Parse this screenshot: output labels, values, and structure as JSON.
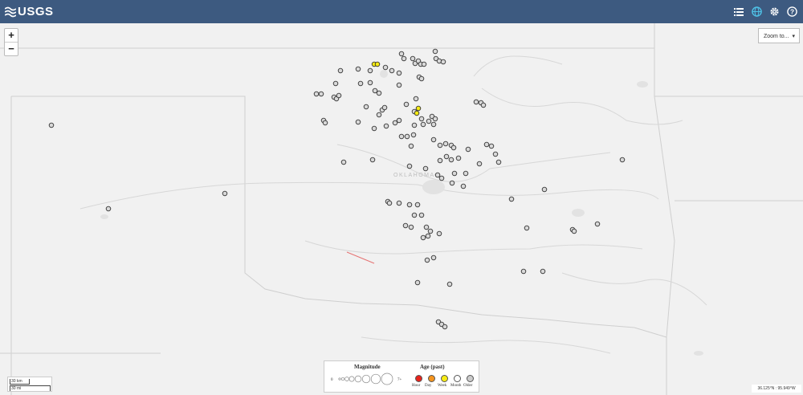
{
  "header": {
    "logo_text": "USGS",
    "icons": [
      "list-icon",
      "globe-icon",
      "gear-icon",
      "help-icon"
    ]
  },
  "map": {
    "state_label": "OKLAHOMA",
    "zoom_in_label": "+",
    "zoom_out_label": "−",
    "zoom_to_label": "Zoom to...",
    "coords_readout": "36.125°N : 95.949°W",
    "scale_km": "30 km",
    "scale_mi": "30 mi"
  },
  "legend": {
    "magnitude_title": "Magnitude",
    "magnitude_min": "0",
    "magnitude_max": "7+",
    "age_title": "Age (past)",
    "ages": [
      {
        "label": "Hour",
        "color": "#e8231b"
      },
      {
        "label": "Day",
        "color": "#f5941d"
      },
      {
        "label": "Week",
        "color": "#f7ec14"
      },
      {
        "label": "Month",
        "color": "#ffffff"
      },
      {
        "label": "Older",
        "color": "#cccccc"
      }
    ]
  },
  "quakes": [
    [
      64,
      156,
      "older"
    ],
    [
      135,
      260,
      "older"
    ],
    [
      280,
      241,
      "older"
    ],
    [
      424,
      88,
      "older"
    ],
    [
      446,
      86,
      "older"
    ],
    [
      461,
      88,
      "older"
    ],
    [
      466,
      80,
      "week"
    ],
    [
      470,
      80,
      "week"
    ],
    [
      480,
      84,
      "older"
    ],
    [
      488,
      88,
      "older"
    ],
    [
      497,
      91,
      "older"
    ],
    [
      500,
      67,
      "older"
    ],
    [
      503,
      73,
      "older"
    ],
    [
      514,
      73,
      "older"
    ],
    [
      517,
      79,
      "older"
    ],
    [
      521,
      76,
      "older"
    ],
    [
      524,
      80,
      "older"
    ],
    [
      528,
      80,
      "older"
    ],
    [
      522,
      96,
      "older"
    ],
    [
      525,
      98,
      "older"
    ],
    [
      542,
      64,
      "older"
    ],
    [
      543,
      73,
      "older"
    ],
    [
      547,
      76,
      "older"
    ],
    [
      552,
      77,
      "older"
    ],
    [
      418,
      104,
      "older"
    ],
    [
      449,
      104,
      "older"
    ],
    [
      461,
      103,
      "older"
    ],
    [
      497,
      106,
      "older"
    ],
    [
      394,
      117,
      "older"
    ],
    [
      400,
      117,
      "older"
    ],
    [
      416,
      121,
      "older"
    ],
    [
      419,
      123,
      "older"
    ],
    [
      422,
      119,
      "older"
    ],
    [
      467,
      113,
      "older"
    ],
    [
      472,
      116,
      "older"
    ],
    [
      456,
      133,
      "older"
    ],
    [
      476,
      137,
      "older"
    ],
    [
      479,
      134,
      "older"
    ],
    [
      506,
      130,
      "older"
    ],
    [
      518,
      123,
      "older"
    ],
    [
      516,
      139,
      "older"
    ],
    [
      519,
      141,
      "week"
    ],
    [
      521,
      135,
      "week"
    ],
    [
      472,
      143,
      "older"
    ],
    [
      525,
      148,
      "older"
    ],
    [
      534,
      151,
      "older"
    ],
    [
      538,
      145,
      "older"
    ],
    [
      542,
      148,
      "older"
    ],
    [
      540,
      155,
      "older"
    ],
    [
      527,
      155,
      "older"
    ],
    [
      516,
      156,
      "older"
    ],
    [
      403,
      150,
      "older"
    ],
    [
      405,
      153,
      "older"
    ],
    [
      446,
      152,
      "older"
    ],
    [
      466,
      160,
      "older"
    ],
    [
      481,
      157,
      "older"
    ],
    [
      492,
      153,
      "older"
    ],
    [
      497,
      150,
      "older"
    ],
    [
      500,
      170,
      "older"
    ],
    [
      507,
      170,
      "older"
    ],
    [
      515,
      168,
      "older"
    ],
    [
      512,
      182,
      "older"
    ],
    [
      540,
      174,
      "older"
    ],
    [
      548,
      181,
      "older"
    ],
    [
      555,
      179,
      "older"
    ],
    [
      562,
      181,
      "older"
    ],
    [
      565,
      184,
      "older"
    ],
    [
      556,
      195,
      "older"
    ],
    [
      548,
      200,
      "older"
    ],
    [
      562,
      199,
      "older"
    ],
    [
      571,
      197,
      "older"
    ],
    [
      583,
      186,
      "older"
    ],
    [
      597,
      204,
      "older"
    ],
    [
      593,
      127,
      "older"
    ],
    [
      599,
      128,
      "older"
    ],
    [
      602,
      131,
      "older"
    ],
    [
      606,
      180,
      "older"
    ],
    [
      612,
      182,
      "older"
    ],
    [
      617,
      192,
      "older"
    ],
    [
      621,
      202,
      "older"
    ],
    [
      428,
      202,
      "older"
    ],
    [
      464,
      199,
      "older"
    ],
    [
      510,
      207,
      "older"
    ],
    [
      530,
      210,
      "older"
    ],
    [
      545,
      218,
      "older"
    ],
    [
      550,
      222,
      "older"
    ],
    [
      566,
      216,
      "older"
    ],
    [
      580,
      216,
      "older"
    ],
    [
      577,
      232,
      "older"
    ],
    [
      563,
      228,
      "older"
    ],
    [
      483,
      251,
      "older"
    ],
    [
      485,
      253,
      "older"
    ],
    [
      497,
      253,
      "older"
    ],
    [
      510,
      255,
      "older"
    ],
    [
      520,
      255,
      "older"
    ],
    [
      516,
      268,
      "older"
    ],
    [
      525,
      268,
      "older"
    ],
    [
      505,
      281,
      "older"
    ],
    [
      512,
      283,
      "older"
    ],
    [
      531,
      283,
      "older"
    ],
    [
      536,
      288,
      "older"
    ],
    [
      533,
      294,
      "older"
    ],
    [
      527,
      296,
      "older"
    ],
    [
      547,
      291,
      "older"
    ],
    [
      532,
      324,
      "older"
    ],
    [
      540,
      321,
      "older"
    ],
    [
      520,
      352,
      "older"
    ],
    [
      560,
      354,
      "older"
    ],
    [
      637,
      248,
      "older"
    ],
    [
      678,
      236,
      "older"
    ],
    [
      656,
      284,
      "older"
    ],
    [
      713,
      286,
      "older"
    ],
    [
      715,
      288,
      "older"
    ],
    [
      744,
      279,
      "older"
    ],
    [
      775,
      199,
      "older"
    ],
    [
      652,
      338,
      "older"
    ],
    [
      676,
      338,
      "older"
    ],
    [
      546,
      401,
      "older"
    ],
    [
      550,
      404,
      "older"
    ],
    [
      554,
      407,
      "older"
    ]
  ]
}
